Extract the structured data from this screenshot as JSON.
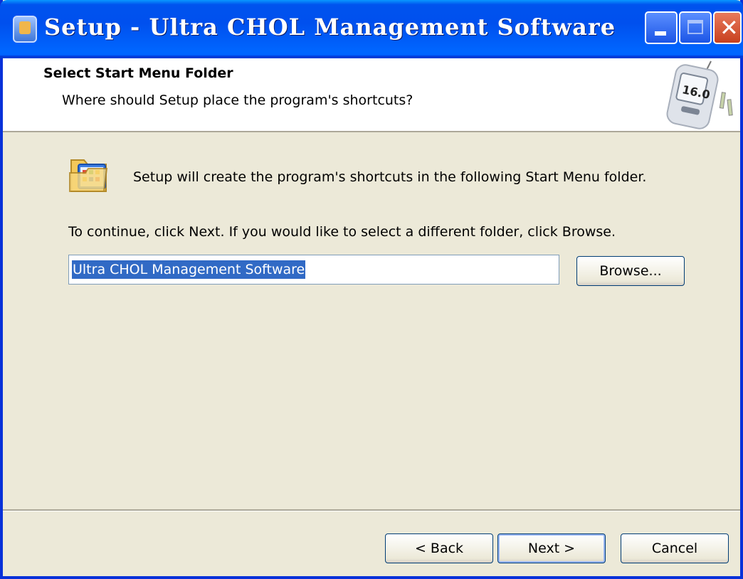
{
  "window": {
    "title": "Setup - Ultra CHOL Management Software",
    "controls": [
      "minimize",
      "maximize",
      "close"
    ]
  },
  "header": {
    "title": "Select Start Menu Folder",
    "subtitle": "Where should Setup place the program's shortcuts?"
  },
  "body": {
    "intro": "Setup will create the program's shortcuts in the following Start Menu folder.",
    "instruction": "To continue, click Next. If you would like to select a different folder, click Browse.",
    "folder_value": "Ultra CHOL Management Software",
    "browse_label": "Browse..."
  },
  "footer": {
    "back_label": "< Back",
    "next_label": "Next >",
    "cancel_label": "Cancel"
  },
  "colors": {
    "titlebar": "#0055e5",
    "dialog_bg": "#ece9d8",
    "selection": "#316ac5"
  },
  "icons": {
    "app": "glucose-meter-icon",
    "header": "glucose-meter-image",
    "folder": "start-menu-folder-icon"
  }
}
